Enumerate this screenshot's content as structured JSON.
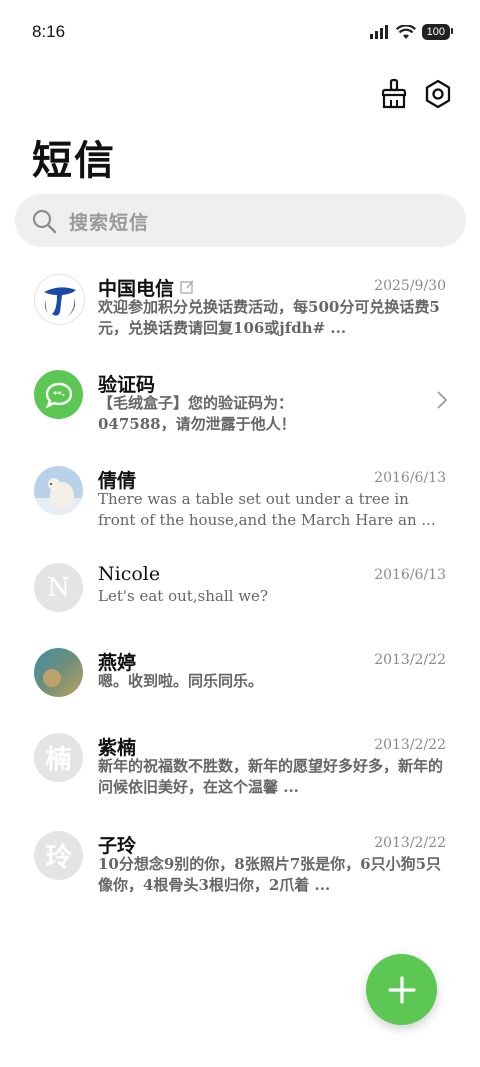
{
  "status": {
    "time": "8:16",
    "battery": "100"
  },
  "header": {
    "title": "短信"
  },
  "search": {
    "placeholder": "搜索短信"
  },
  "messages": [
    {
      "name": "中国电信",
      "date": "2025/9/30",
      "preview": "欢迎参加积分兑换话费活动，每500分可兑换话费5元，兑换话费请回复106或jfdh# ..."
    },
    {
      "name": "验证码",
      "date": "",
      "preview": "【毛绒盒子】您的验证码为：047588，请勿泄露于他人！"
    },
    {
      "name": "倩倩",
      "date": "2016/6/13",
      "preview": "There was a table set out under a tree in front of the house,and the March Hare an ..."
    },
    {
      "name": "Nicole",
      "date": "2016/6/13",
      "preview": "Let's eat out,shall we?",
      "initial": "N"
    },
    {
      "name": "燕婷",
      "date": "2013/2/22",
      "preview": "嗯。收到啦。同乐同乐。"
    },
    {
      "name": "紫楠",
      "date": "2013/2/22",
      "preview": "新年的祝福数不胜数，新年的愿望好多好多，新年的问候依旧美好，在这个温馨 ...",
      "initial": "楠"
    },
    {
      "name": "子玲",
      "date": "2013/2/22",
      "preview": "10分想念9别的你，8张照片7张是你，6只小狗5只像你，4根骨头3根归你，2爪着 ...",
      "initial": "玲"
    }
  ],
  "colors": {
    "accent": "#5cc752",
    "telecom": "#1a4aa8"
  },
  "icons": {
    "clean": "broom-icon",
    "settings": "gear-icon",
    "compose": "plus-icon"
  }
}
